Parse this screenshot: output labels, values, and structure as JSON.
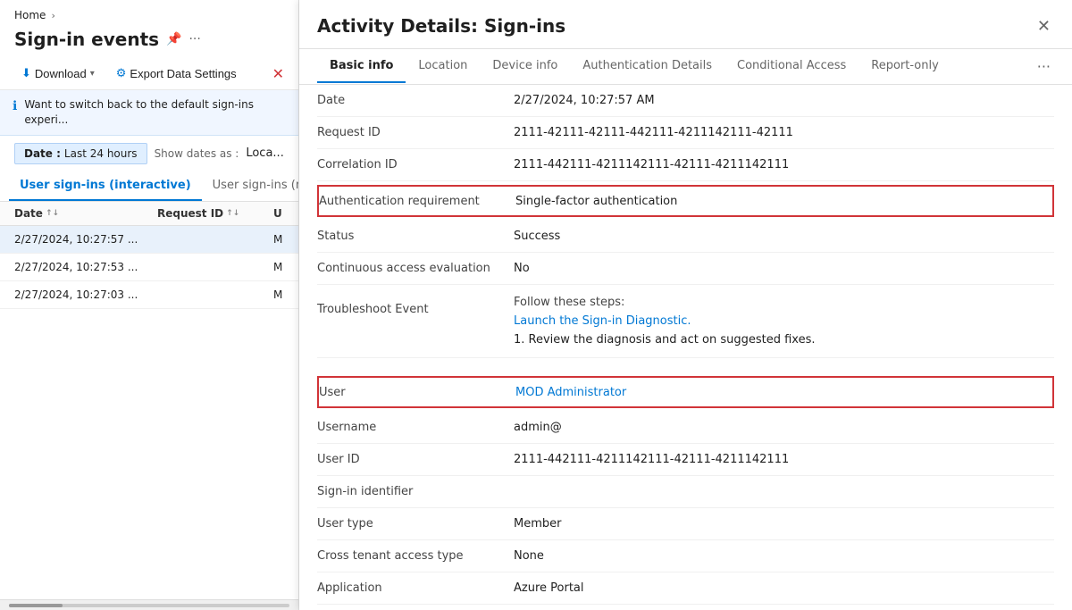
{
  "leftPanel": {
    "breadcrumb": {
      "home": "Home",
      "chevron": "›"
    },
    "title": "Sign-in events",
    "toolbar": {
      "download": "Download",
      "exportSettings": "Export Data Settings"
    },
    "infoBanner": "Want to switch back to the default sign-ins experi...",
    "filters": {
      "dateLabel": "Date",
      "dateValue": "Last 24 hours",
      "separator": "Show dates as :",
      "localeValue": "Loca..."
    },
    "tabs": [
      {
        "id": "interactive",
        "label": "User sign-ins (interactive)",
        "active": true
      },
      {
        "id": "non-interactive",
        "label": "User sign-ins (non...",
        "active": false
      }
    ],
    "tableColumns": [
      {
        "label": "Date",
        "sort": true
      },
      {
        "label": "Request ID",
        "sort": true
      },
      {
        "label": "U",
        "sort": false
      }
    ],
    "tableRows": [
      {
        "date": "2/27/2024, 10:27:57 ...",
        "requestId": "",
        "u": "M",
        "selected": true
      },
      {
        "date": "2/27/2024, 10:27:53 ...",
        "requestId": "",
        "u": "M",
        "selected": false
      },
      {
        "date": "2/27/2024, 10:27:03 ...",
        "requestId": "",
        "u": "M",
        "selected": false
      }
    ]
  },
  "modal": {
    "title": "Activity Details: Sign-ins",
    "tabs": [
      {
        "id": "basic",
        "label": "Basic info",
        "active": true
      },
      {
        "id": "location",
        "label": "Location",
        "active": false
      },
      {
        "id": "device",
        "label": "Device info",
        "active": false
      },
      {
        "id": "auth",
        "label": "Authentication Details",
        "active": false
      },
      {
        "id": "conditional",
        "label": "Conditional Access",
        "active": false
      },
      {
        "id": "report",
        "label": "Report-only",
        "active": false
      }
    ],
    "moreIcon": "···",
    "details": {
      "date": {
        "label": "Date",
        "value": "2/27/2024, 10:27:57 AM"
      },
      "requestId": {
        "label": "Request ID",
        "value": "2111-42111-42111-442111-4211142111-42111"
      },
      "correlationId": {
        "label": "Correlation ID",
        "value": "2111-442111-4211142111-42111-4211142111"
      },
      "authRequirement": {
        "label": "Authentication requirement",
        "value": "Single-factor authentication",
        "highlighted": true
      },
      "status": {
        "label": "Status",
        "value": "Success"
      },
      "continuousAccess": {
        "label": "Continuous access evaluation",
        "value": "No"
      },
      "troubleshoot": {
        "label": "Troubleshoot Event",
        "followSteps": "Follow these steps:",
        "link": "Launch the Sign-in Diagnostic.",
        "note": "1. Review the diagnosis and act on suggested fixes."
      },
      "user": {
        "label": "User",
        "value": "MOD Administrator",
        "isLink": true,
        "highlighted": true
      },
      "username": {
        "label": "Username",
        "value": "admin@"
      },
      "userId": {
        "label": "User ID",
        "value": "2111-442111-4211142111-42111-4211142111"
      },
      "signInIdentifier": {
        "label": "Sign-in identifier",
        "value": ""
      },
      "userType": {
        "label": "User type",
        "value": "Member"
      },
      "crossTenant": {
        "label": "Cross tenant access type",
        "value": "None"
      },
      "application": {
        "label": "Application",
        "value": "Azure Portal"
      }
    }
  }
}
